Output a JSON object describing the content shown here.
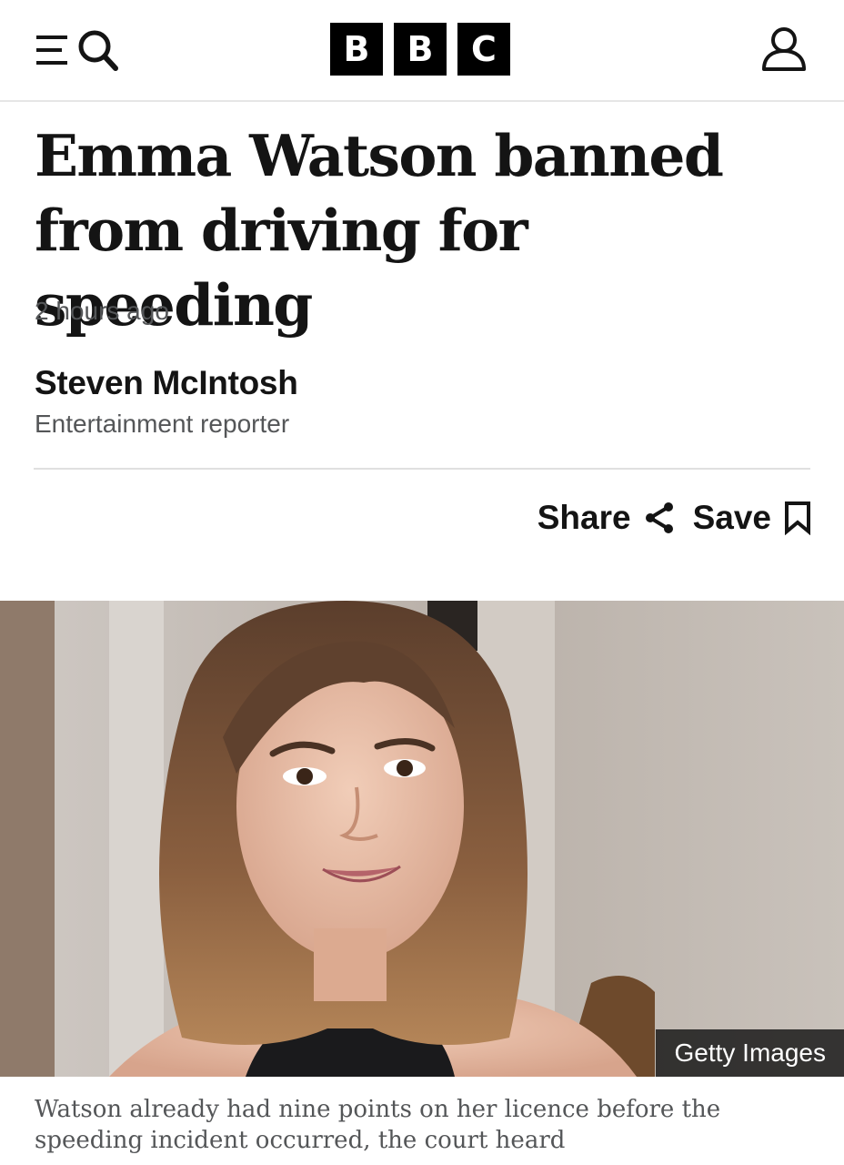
{
  "header": {
    "menu_icon": "menu-icon",
    "search_icon": "search-icon",
    "logo": [
      "B",
      "B",
      "C"
    ],
    "account_icon": "account-icon"
  },
  "article": {
    "headline_line1": "Emma Watson banned",
    "headline_line2": "from driving for speeding",
    "timestamp": "2 hours ago",
    "author_name": "Steven McIntosh",
    "author_role": "Entertainment reporter"
  },
  "actions": {
    "share_label": "Share",
    "share_icon": "share-icon",
    "save_label": "Save",
    "save_icon": "bookmark-icon"
  },
  "image": {
    "credit": "Getty Images",
    "caption": "Watson already had nine points on her licence before the speeding incident occurred, the court heard"
  },
  "colors": {
    "text_primary": "#141414",
    "text_secondary": "#545658",
    "logo_block": "#000000",
    "divider": "#e0e0e0"
  }
}
